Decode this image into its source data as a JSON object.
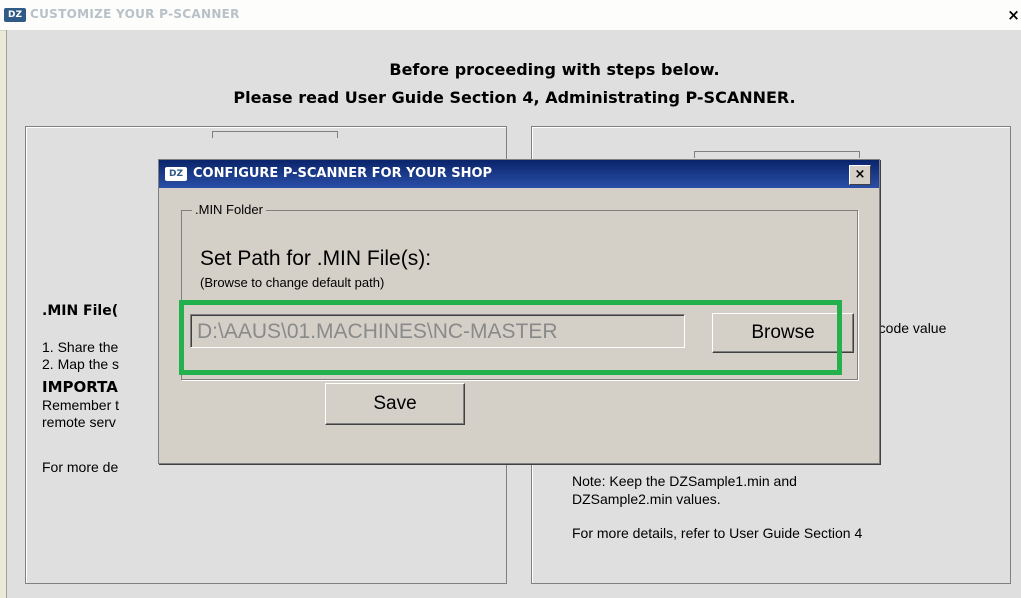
{
  "main_window": {
    "logo": "DZ",
    "title": "CUSTOMIZE YOUR P-SCANNER",
    "close": "×",
    "heading_line1": "Before proceeding with steps below.",
    "heading_line2": "Please read User Guide Section 4, Administrating P-SCANNER."
  },
  "left_panel": {
    "section_title": ".MIN File(",
    "step1": "1. Share the",
    "step2": "2. Map the s",
    "important": "IMPORTA",
    "remember": "Remember t",
    "remote": "remote serv",
    "more_details": "For more de"
  },
  "right_panel": {
    "barcode_text": "rcode value",
    "note_line1": "Note: Keep the DZSample1.min and",
    "note_line2": "DZSample2.min values.",
    "more_details": "For more details, refer to User Guide Section 4"
  },
  "dialog": {
    "logo": "DZ",
    "title": "CONFIGURE P-SCANNER FOR YOUR SHOP",
    "close": "×",
    "group_label": ".MIN Folder",
    "set_path_label": "Set Path for .MIN File(s):",
    "browse_hint": "(Browse to change default path)",
    "path_value": "D:\\AAUS\\01.MACHINES\\NC-MASTER",
    "browse_label": "Browse",
    "save_label": "Save"
  },
  "colors": {
    "highlight": "#22b14c",
    "dialog_titlebar": "#0a246a",
    "logo": "#2f5b86"
  }
}
